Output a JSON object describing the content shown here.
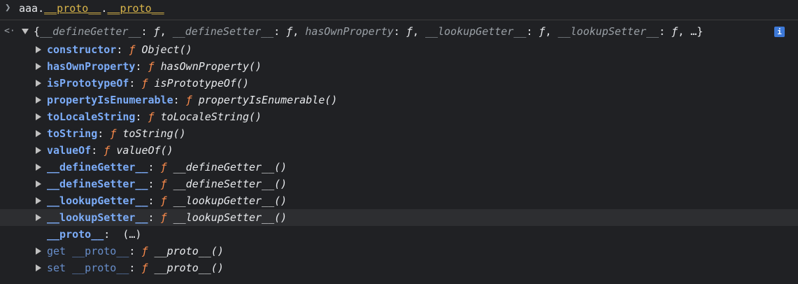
{
  "input": {
    "object": "aaa",
    "dot": ".",
    "props": [
      "__proto__",
      "__proto__"
    ]
  },
  "summary": {
    "open": "{",
    "entries": [
      {
        "key": "__defineGetter__",
        "value": "ƒ"
      },
      {
        "key": "__defineSetter__",
        "value": "ƒ"
      },
      {
        "key": "hasOwnProperty",
        "value": "ƒ"
      },
      {
        "key": "__lookupGetter__",
        "value": "ƒ"
      },
      {
        "key": "__lookupSetter__",
        "value": "ƒ"
      }
    ],
    "ellipsis": "…",
    "close": "}",
    "info_icon": "i"
  },
  "rows": [
    {
      "key": "constructor",
      "f": "ƒ",
      "name": "Object()",
      "expandable": true
    },
    {
      "key": "hasOwnProperty",
      "f": "ƒ",
      "name": "hasOwnProperty()",
      "expandable": true
    },
    {
      "key": "isPrototypeOf",
      "f": "ƒ",
      "name": "isPrototypeOf()",
      "expandable": true
    },
    {
      "key": "propertyIsEnumerable",
      "f": "ƒ",
      "name": "propertyIsEnumerable()",
      "expandable": true
    },
    {
      "key": "toLocaleString",
      "f": "ƒ",
      "name": "toLocaleString()",
      "expandable": true
    },
    {
      "key": "toString",
      "f": "ƒ",
      "name": "toString()",
      "expandable": true
    },
    {
      "key": "valueOf",
      "f": "ƒ",
      "name": "valueOf()",
      "expandable": true
    },
    {
      "key": "__defineGetter__",
      "f": "ƒ",
      "name": "__defineGetter__()",
      "expandable": true
    },
    {
      "key": "__defineSetter__",
      "f": "ƒ",
      "name": "__defineSetter__()",
      "expandable": true
    },
    {
      "key": "__lookupGetter__",
      "f": "ƒ",
      "name": "__lookupGetter__()",
      "expandable": true
    },
    {
      "key": "__lookupSetter__",
      "f": "ƒ",
      "name": "__lookupSetter__()",
      "expandable": true,
      "highlighted": true
    },
    {
      "key": "__proto__",
      "f": "",
      "name": "(…)",
      "expandable": false
    },
    {
      "key": "get __proto__",
      "f": "ƒ",
      "name": "__proto__()",
      "expandable": true,
      "dim": true
    },
    {
      "key": "set __proto__",
      "f": "ƒ",
      "name": "__proto__()",
      "expandable": true,
      "dim": true
    }
  ]
}
